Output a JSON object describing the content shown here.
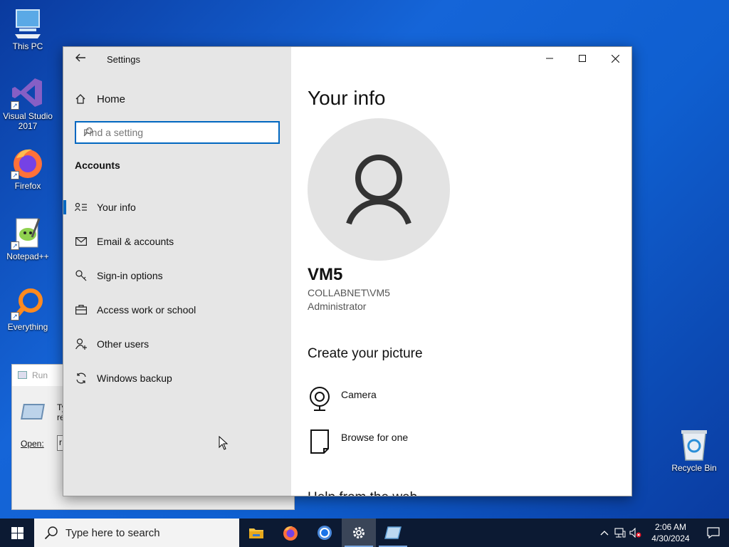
{
  "desktop": {
    "icons": [
      {
        "label": "This PC",
        "icon": "computer-icon"
      },
      {
        "label": "Visual Studio 2017",
        "icon": "visual-studio-icon"
      },
      {
        "label": "Firefox",
        "icon": "firefox-icon"
      },
      {
        "label": "Notepad++",
        "icon": "notepadpp-icon"
      },
      {
        "label": "Everything",
        "icon": "everything-icon"
      },
      {
        "label": "Recycle Bin",
        "icon": "recycle-bin-icon"
      }
    ]
  },
  "run_dialog": {
    "title": "Run",
    "text_fragment": "Ty\nre",
    "open_label": "Open:",
    "input_fragment": "r"
  },
  "settings": {
    "app_title": "Settings",
    "home_label": "Home",
    "search_placeholder": "Find a setting",
    "section_header": "Accounts",
    "nav_items": [
      {
        "label": "Your info",
        "icon": "person-list-icon",
        "active": true
      },
      {
        "label": "Email & accounts",
        "icon": "mail-icon",
        "active": false
      },
      {
        "label": "Sign-in options",
        "icon": "key-icon",
        "active": false
      },
      {
        "label": "Access work or school",
        "icon": "briefcase-icon",
        "active": false
      },
      {
        "label": "Other users",
        "icon": "add-person-icon",
        "active": false
      },
      {
        "label": "Windows backup",
        "icon": "sync-icon",
        "active": false
      }
    ],
    "content": {
      "page_title": "Your info",
      "user_name": "VM5",
      "account": "COLLABNET\\VM5",
      "role": "Administrator",
      "create_picture_header": "Create your picture",
      "picture_options": [
        {
          "label": "Camera",
          "icon": "camera-icon"
        },
        {
          "label": "Browse for one",
          "icon": "file-icon"
        }
      ],
      "cut_off_header": "Help from the web"
    }
  },
  "taskbar": {
    "search_placeholder": "Type here to search",
    "apps": [
      {
        "name": "file-explorer",
        "icon": "folder-icon"
      },
      {
        "name": "firefox",
        "icon": "firefox-icon"
      },
      {
        "name": "chrome",
        "icon": "chrome-icon"
      },
      {
        "name": "settings",
        "icon": "gear-icon",
        "active": true
      },
      {
        "name": "run",
        "icon": "run-icon"
      }
    ],
    "time": "2:06 AM",
    "date": "4/30/2024"
  },
  "colors": {
    "accent": "#0067c0",
    "nav_bg": "#e6e6e6",
    "taskbar_bg": "#0c1a33"
  }
}
